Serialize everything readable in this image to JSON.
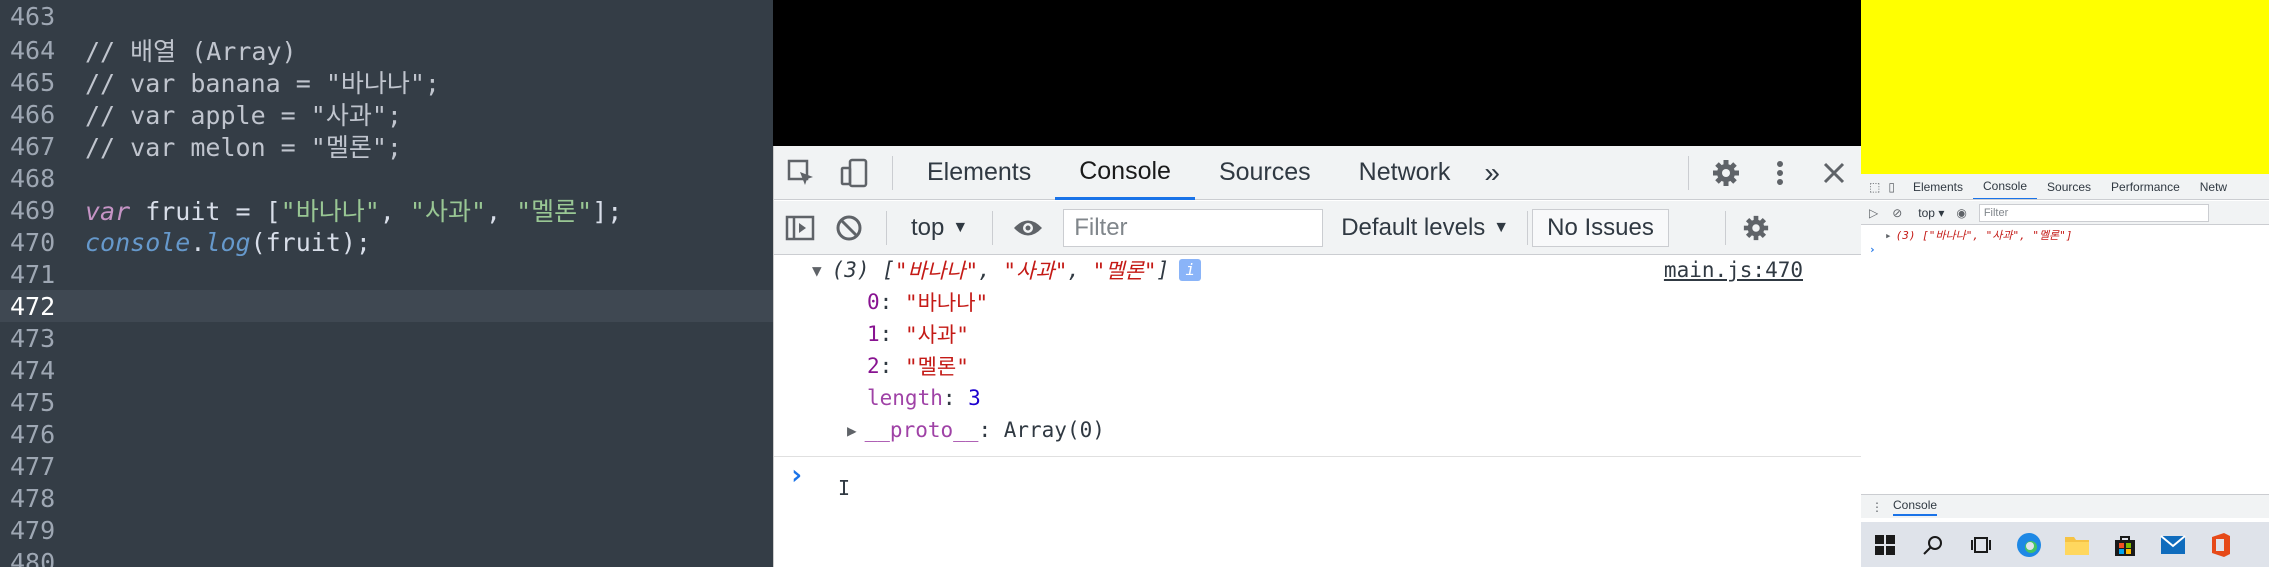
{
  "editor": {
    "lines": [
      {
        "num": "463",
        "code": ""
      },
      {
        "num": "464",
        "code": "// 배열 (Array)"
      },
      {
        "num": "465",
        "code": "// var banana = \"바나나\";"
      },
      {
        "num": "466",
        "code": "// var apple = \"사과\";"
      },
      {
        "num": "467",
        "code": "// var melon = \"멜론\";"
      },
      {
        "num": "468",
        "code": ""
      },
      {
        "num": "469",
        "kw": "var",
        "name": " fruit = [",
        "s1": "\"바나나\"",
        "c1": ", ",
        "s2": "\"사과\"",
        "c2": ", ",
        "s3": "\"멜론\"",
        "end": "];"
      },
      {
        "num": "470",
        "obj": "console",
        "dot": ".",
        "fn": "log",
        "rest": "(fruit);"
      },
      {
        "num": "471",
        "code": ""
      },
      {
        "num": "472",
        "code": ""
      },
      {
        "num": "473",
        "code": ""
      },
      {
        "num": "474",
        "code": ""
      },
      {
        "num": "475",
        "code": ""
      },
      {
        "num": "476",
        "code": ""
      },
      {
        "num": "477",
        "code": ""
      },
      {
        "num": "478",
        "code": ""
      },
      {
        "num": "479",
        "code": ""
      },
      {
        "num": "480",
        "code": ""
      }
    ],
    "active_line": "472"
  },
  "devtools": {
    "tabs": [
      "Elements",
      "Console",
      "Sources",
      "Network"
    ],
    "selected_tab": "Console",
    "more_tabs": "»",
    "toolbar": {
      "context": "top",
      "filter_placeholder": "Filter",
      "levels": "Default levels",
      "issues": "No Issues"
    },
    "console": {
      "summary_prefix": "(3) [",
      "summary_s1": "\"바나나\"",
      "summary_s2": "\"사과\"",
      "summary_s3": "\"멜론\"",
      "summary_sep": ", ",
      "summary_end": "]",
      "info": "i",
      "source_link": "main.js:470",
      "items": [
        {
          "key": "0",
          "value": "\"바나나\""
        },
        {
          "key": "1",
          "value": "\"사과\""
        },
        {
          "key": "2",
          "value": "\"멜론\""
        }
      ],
      "length_key": "length",
      "length_value": "3",
      "proto_key": "__proto__",
      "proto_value": ": Array(0)",
      "prompt": "›"
    }
  },
  "mini_devtools": {
    "tabs": [
      "Elements",
      "Console",
      "Sources",
      "Performance",
      "Netw"
    ],
    "selected_tab": "Console",
    "context": "top",
    "filter_placeholder": "Filter",
    "log": "(3) [\"바나나\", \"사과\", \"멜론\"]",
    "prompt": "›",
    "drawer_label": "Console"
  },
  "colors": {
    "editor_bg": "#343d46",
    "yellow": "#ffff00",
    "accent": "#1a73e8"
  }
}
